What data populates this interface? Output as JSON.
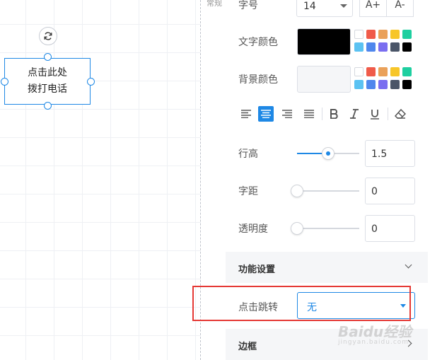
{
  "canvas": {
    "tab_label": "常规",
    "text_box": {
      "line1": "点击此处",
      "line2": "拨打电话"
    }
  },
  "panel": {
    "font_size": {
      "label": "字号",
      "value": "14",
      "increase_label": "A+",
      "decrease_label": "A-"
    },
    "text_color": {
      "label": "文字颜色",
      "current": "#000000"
    },
    "bg_color": {
      "label": "背景颜色",
      "current": "#f5f6f8"
    },
    "palette": [
      "#ffffff",
      "#f05b4a",
      "#eaa15a",
      "#f7c629",
      "#1ecfa0",
      "#5bc2f2",
      "#4f87ed",
      "#7a6ef0",
      "#4a5568",
      "#000000"
    ],
    "line_height": {
      "label": "行高",
      "value": "1.5",
      "fraction": 0.5
    },
    "letter_spacing": {
      "label": "字距",
      "value": "0",
      "fraction": 0
    },
    "opacity": {
      "label": "透明度",
      "value": "0",
      "fraction": 0
    },
    "function_section": {
      "title": "功能设置"
    },
    "click_jump": {
      "label": "点击跳转",
      "value": "无"
    },
    "border_section": {
      "title": "边框"
    }
  },
  "watermark": {
    "main": "Baidu经验",
    "sub": "jingyan.baidu.com"
  },
  "colors": {
    "accent": "#1e88e5",
    "highlight": "#e53935"
  }
}
